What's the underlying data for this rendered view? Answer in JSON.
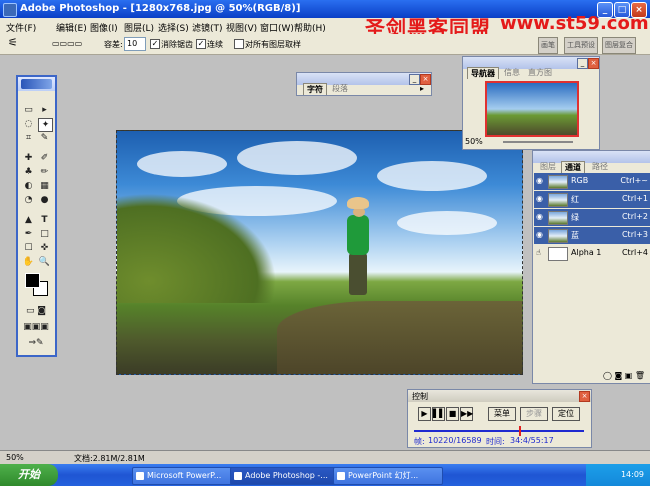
{
  "window": {
    "title": "Adobe Photoshop - [1280x768.jpg @ 50%(RGB/8)]",
    "minimize": "_",
    "maximize": "□",
    "close": "×"
  },
  "menu": [
    "文件(F)",
    "编辑(E)",
    "图像(I)",
    "图层(L)",
    "选择(S)",
    "滤镜(T)",
    "视图(V)",
    "窗口(W)",
    "帮助(H)"
  ],
  "watermark": {
    "cn": "圣剑黑客同盟",
    "url": "www.st59.com"
  },
  "options": {
    "tolerance_label": "容差:",
    "tolerance_value": "10",
    "antialias_label": "消除锯齿",
    "contiguous_label": "连续",
    "all_layers_label": "对所有图层取样"
  },
  "palette_well_tabs": [
    "画笔",
    "工具预设",
    "图层复合"
  ],
  "toolbox": {
    "tools": [
      "▭",
      "▸",
      "◌",
      "✦",
      "⌗",
      "✎",
      "✚",
      "✐",
      "♣",
      "✏",
      "◐",
      "▦",
      "◔",
      "●",
      "▲",
      "T",
      "✒",
      "□",
      "☐",
      "✜",
      "✋",
      "🔍"
    ]
  },
  "char_panel": {
    "tabs": [
      "字符",
      "段落"
    ]
  },
  "navigator": {
    "tabs": [
      "导航器",
      "信息",
      "直方图"
    ],
    "zoom": "50%"
  },
  "channels": {
    "tabs": [
      "图层",
      "通道",
      "路径"
    ],
    "rows": [
      {
        "name": "RGB",
        "key": "Ctrl+~"
      },
      {
        "name": "红",
        "key": "Ctrl+1"
      },
      {
        "name": "绿",
        "key": "Ctrl+2"
      },
      {
        "name": "蓝",
        "key": "Ctrl+3"
      },
      {
        "name": "Alpha 1",
        "key": "Ctrl+4"
      }
    ]
  },
  "control": {
    "title": "控制",
    "buttons": [
      "菜单",
      "步骤",
      "定位"
    ],
    "frame_label": "帧:",
    "frame_value": "10220/16589",
    "time_label": "时间:",
    "time_value": "34:4/55:17",
    "progress": 0.62
  },
  "status": {
    "zoom": "50%",
    "doc": "文档:2.81M/2.81M"
  },
  "taskbar": {
    "start": "开始",
    "tasks": [
      "Microsoft PowerP...",
      "Adobe Photoshop -...",
      "PowerPoint 幻灯..."
    ],
    "clock": "14:09"
  }
}
